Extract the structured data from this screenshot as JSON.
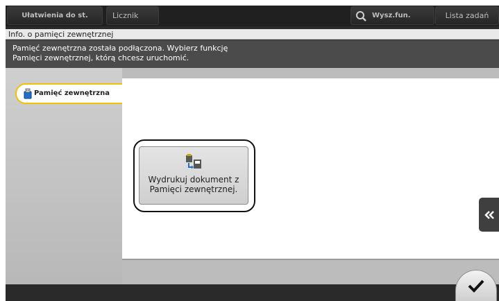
{
  "top_tabs": {
    "settings": "Ułatwienia do st.",
    "counter": "Licznik",
    "search": "Wysz.fun.",
    "jobs": "Lista zadań"
  },
  "title": "Info. o pamięci zewnętrznej",
  "message": {
    "line1": "Pamięć zewnętrzna została podłączona. Wybierz funkcję",
    "line2": "Pamięci zewnętrznej, którą chcesz uruchomić."
  },
  "sidebar": {
    "selected_tab": "Pamięć zewnętrzna"
  },
  "function": {
    "label": "Wydrukuj dokument z Pamięci zewnętrznej."
  },
  "colors": {
    "highlight": "#f2c200",
    "frame": "#2b2b2b",
    "message_bg": "#4b4b4b"
  },
  "icons": {
    "search": "magnifier-icon",
    "usb": "usb-icon",
    "print_from_memory": "print-from-usb-icon",
    "collapse": "double-chevron-left-icon",
    "ok": "checkmark-icon"
  }
}
